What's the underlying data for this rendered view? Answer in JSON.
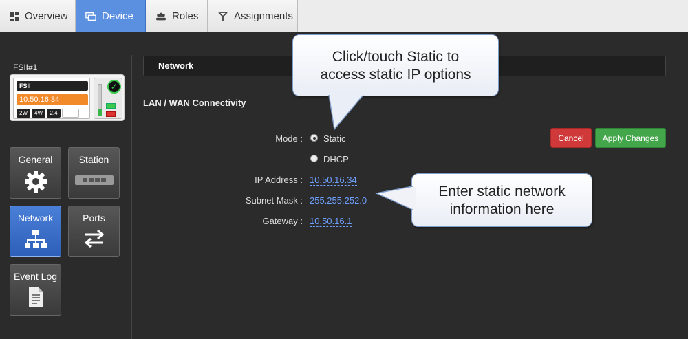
{
  "tabs": [
    {
      "label": "Overview",
      "icon": "dashboard-icon",
      "active": false
    },
    {
      "label": "Device",
      "icon": "device-icon",
      "active": true
    },
    {
      "label": "Roles",
      "icon": "users-icon",
      "active": false
    },
    {
      "label": "Assignments",
      "icon": "assignments-icon",
      "active": false
    }
  ],
  "device": {
    "name": "FSII#1",
    "model_label": "FSII",
    "ip": "10.50.16.34",
    "chips": [
      "2W",
      "4W",
      "2.4"
    ],
    "status": "connected"
  },
  "nav": {
    "general": "General",
    "station": "Station",
    "network": "Network",
    "ports": "Ports",
    "event_log": "Event Log"
  },
  "section": {
    "title": "Network",
    "subtitle": "LAN / WAN Connectivity"
  },
  "form": {
    "mode_label": "Mode :",
    "static_label": "Static",
    "dhcp_label": "DHCP",
    "selected_mode": "Static",
    "ip_label": "IP Address :",
    "ip_value": "10.50.16.34",
    "mask_label": "Subnet Mask :",
    "mask_value": "255.255.252.0",
    "gateway_label": "Gateway :",
    "gateway_value": "10.50.16.1"
  },
  "buttons": {
    "cancel": "Cancel",
    "apply": "Apply Changes"
  },
  "callouts": {
    "static_line1": "Click/touch Static to",
    "static_line2": "access static IP options",
    "network_line1": "Enter static network",
    "network_line2": "information here"
  },
  "colors": {
    "accent": "#5b8fe0",
    "cancel": "#d0393a",
    "apply": "#43a64a",
    "link": "#6ea0ff",
    "ip_badge": "#f28a2a"
  }
}
